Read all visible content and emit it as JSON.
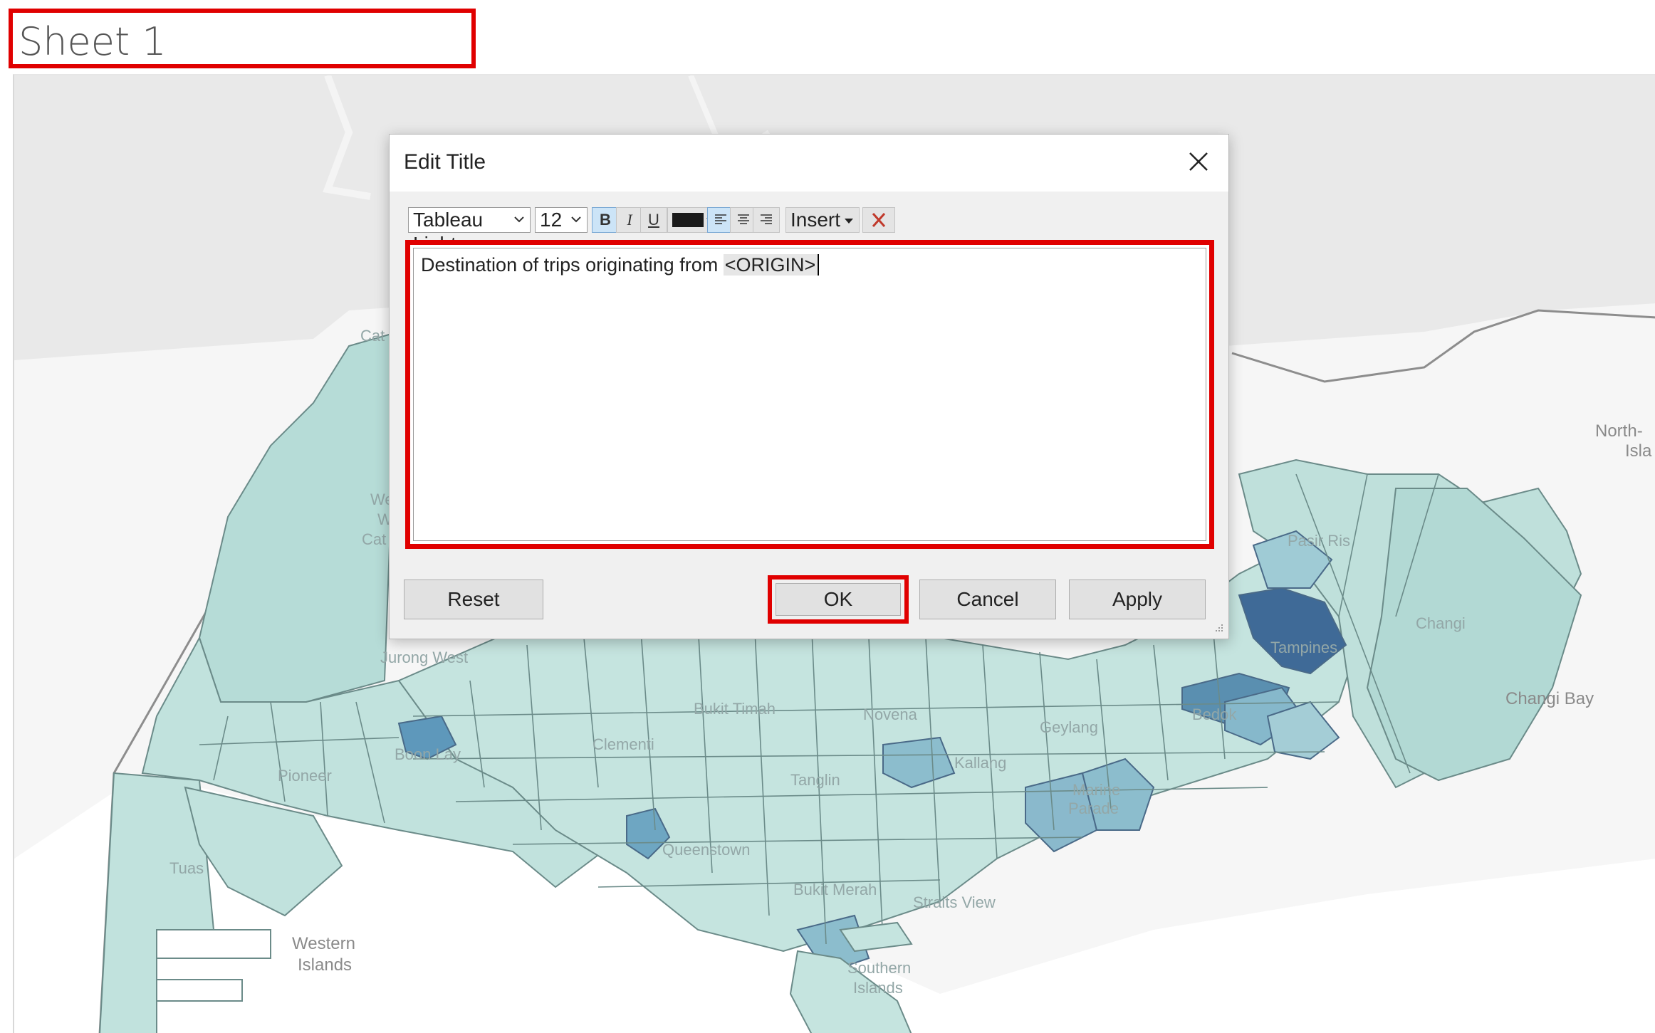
{
  "sheet": {
    "title": "Sheet 1"
  },
  "map": {
    "labels": {
      "north_island": "North-",
      "north_island_2": "Isla",
      "changi": "Changi",
      "changi_bay": "Changi Bay",
      "tampines": "Tampines",
      "bedok": "Bedok",
      "pasir_ris": "Pasir Ris",
      "geylang": "Geylang",
      "marine_parade": "Marine",
      "marine_parade_2": "Parade",
      "western_islands": "Western",
      "western_islands_2": "Islands",
      "tuas": "Tuas",
      "jurong_west": "Jurong West",
      "pioneer": "Pioneer",
      "boon_lay": "Boon Lay",
      "bukit_timah": "Bukit Timah",
      "clementi": "Clementi",
      "novena": "Novena",
      "kallang": "Kallang",
      "tanglin": "Tanglin",
      "queenstown": "Queenstown",
      "bukit_merah": "Bukit Merah",
      "straits_view": "Straits View",
      "southern_islands": "Southern",
      "southern_islands_2": "Islands",
      "western_catchment": "We",
      "western_catchment_2": "W",
      "western_catchment_3": "Cat",
      "cat": "Cat"
    },
    "colors": {
      "water": "#ffffff",
      "land": "#e4e4e4",
      "choropleth_low": "#b9ddd8",
      "choropleth_mid": "#7fb2c9",
      "choropleth_high": "#3f6a97"
    }
  },
  "dialog": {
    "title": "Edit Title",
    "close_icon": "close-icon",
    "toolbar": {
      "font_family": "Tableau Light",
      "font_size": "12",
      "bold": "B",
      "italic": "I",
      "underline": "U",
      "text_color": "#1a1a1a",
      "insert": "Insert",
      "clear_icon": "clear-formatting-icon"
    },
    "editor": {
      "text": "Destination of trips originating from ",
      "field": "<ORIGIN>"
    },
    "buttons": {
      "reset": "Reset",
      "ok": "OK",
      "cancel": "Cancel",
      "apply": "Apply"
    }
  },
  "highlight_color": "#e00000"
}
